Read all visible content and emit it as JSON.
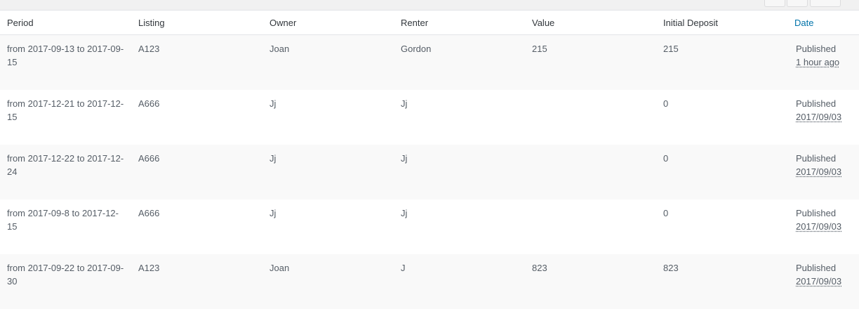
{
  "table": {
    "columns": [
      "Period",
      "Listing",
      "Owner",
      "Renter",
      "Value",
      "Initial Deposit",
      "Date"
    ],
    "rows": [
      {
        "period": "from 2017-09-13 to 2017-09-15",
        "listing": "A123",
        "owner": "Joan",
        "renter": "Gordon",
        "value": "215",
        "deposit": "215",
        "status": "Published",
        "date": "1 hour ago"
      },
      {
        "period": "from 2017-12-21 to 2017-12-15",
        "listing": "A666",
        "owner": "Jj",
        "renter": "Jj",
        "value": "",
        "deposit": "0",
        "status": "Published",
        "date": "2017/09/03"
      },
      {
        "period": "from 2017-12-22 to 2017-12-24",
        "listing": "A666",
        "owner": "Jj",
        "renter": "Jj",
        "value": "",
        "deposit": "0",
        "status": "Published",
        "date": "2017/09/03"
      },
      {
        "period": "from 2017-09-8 to 2017-12-15",
        "listing": "A666",
        "owner": "Jj",
        "renter": "Jj",
        "value": "",
        "deposit": "0",
        "status": "Published",
        "date": "2017/09/03"
      },
      {
        "period": "from 2017-09-22 to 2017-09-30",
        "listing": "A123",
        "owner": "Joan",
        "renter": "J",
        "value": "823",
        "deposit": "823",
        "status": "Published",
        "date": "2017/09/03"
      }
    ]
  }
}
